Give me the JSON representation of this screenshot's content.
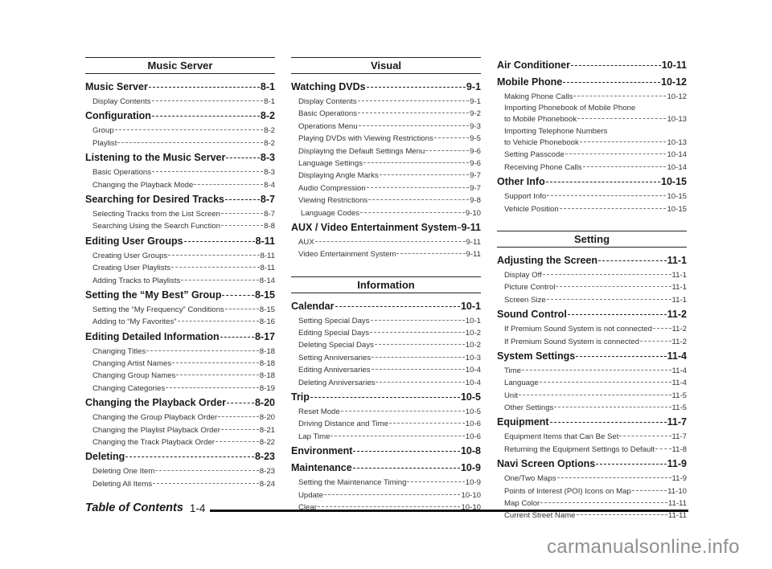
{
  "columns": [
    {
      "sections": [
        {
          "header": "Music Server",
          "entries": [
            {
              "title": "Music Server",
              "page": "8-1",
              "level": 1
            },
            {
              "title": "Display Contents",
              "page": "8-1",
              "level": 2
            },
            {
              "title": "Configuration",
              "page": "8-2",
              "level": 1
            },
            {
              "title": "Group",
              "page": "8-2",
              "level": 2
            },
            {
              "title": "Playlist",
              "page": "8-2",
              "level": 2
            },
            {
              "title": "Listening to the Music Server",
              "page": "8-3",
              "level": 1
            },
            {
              "title": "Basic Operations",
              "page": "8-3",
              "level": 2
            },
            {
              "title": "Changing the Playback Mode",
              "page": "8-4",
              "level": 2
            },
            {
              "title": "Searching for Desired Tracks",
              "page": "8-7",
              "level": 1
            },
            {
              "title": "Selecting Tracks from the List Screen",
              "page": "8-7",
              "level": 2
            },
            {
              "title": "Searching Using the Search Function",
              "page": "8-8",
              "level": 2
            },
            {
              "title": "Editing User Groups",
              "page": "8-11",
              "level": 1
            },
            {
              "title": "Creating User Groups",
              "page": "8-11",
              "level": 2
            },
            {
              "title": "Creating User Playlists",
              "page": "8-11",
              "level": 2
            },
            {
              "title": "Adding Tracks to Playlists",
              "page": "8-14",
              "level": 2
            },
            {
              "title": "Setting the “My Best” Group",
              "page": "8-15",
              "level": 1
            },
            {
              "title": "Setting the “My Frequency” Conditions",
              "page": "8-15",
              "level": 2
            },
            {
              "title": "Adding to “My Favorites”",
              "page": "8-16",
              "level": 2
            },
            {
              "title": "Editing Detailed Information",
              "page": "8-17",
              "level": 1
            },
            {
              "title": "Changing Titles",
              "page": "8-18",
              "level": 2
            },
            {
              "title": "Changing Artist Names",
              "page": "8-18",
              "level": 2
            },
            {
              "title": "Changing Group Names",
              "page": "8-18",
              "level": 2
            },
            {
              "title": "Changing Categories",
              "page": "8-19",
              "level": 2
            },
            {
              "title": "Changing the Playback Order",
              "page": "8-20",
              "level": 1
            },
            {
              "title": "Changing the Group Playback Order",
              "page": "8-20",
              "level": 2
            },
            {
              "title": "Changing the Playlist Playback Order",
              "page": "8-21",
              "level": 2
            },
            {
              "title": "Changing the Track Playback Order",
              "page": "8-22",
              "level": 2
            },
            {
              "title": "Deleting",
              "page": "8-23",
              "level": 1
            },
            {
              "title": "Deleting One Item",
              "page": "8-23",
              "level": 2
            },
            {
              "title": "Deleting All Items",
              "page": "8-24",
              "level": 2
            }
          ]
        }
      ]
    },
    {
      "sections": [
        {
          "header": "Visual",
          "entries": [
            {
              "title": "Watching DVDs",
              "page": "9-1",
              "level": 1
            },
            {
              "title": "Display Contents",
              "page": "9-1",
              "level": 2
            },
            {
              "title": "Basic Operations",
              "page": "9-2",
              "level": 2
            },
            {
              "title": "Operations Menu",
              "page": "9-3",
              "level": 2
            },
            {
              "title": "Playing DVDs with Viewing Restrictions",
              "page": "9-5",
              "level": 2
            },
            {
              "title": "Displaying the Default Settings Menu",
              "page": "9-6",
              "level": 2
            },
            {
              "title": "Language Settings",
              "page": "9-6",
              "level": 2
            },
            {
              "title": "Displaying Angle Marks",
              "page": "9-7",
              "level": 2
            },
            {
              "title": "Audio Compression",
              "page": "9-7",
              "level": 2
            },
            {
              "title": "Viewing Restrictions",
              "page": "9-8",
              "level": 2
            },
            {
              "title": "Language Codes",
              "page": "9-10",
              "level": 3
            },
            {
              "title": "AUX / Video Entertainment System",
              "page": "9-11",
              "level": 1
            },
            {
              "title": "AUX",
              "page": "9-11",
              "level": 2
            },
            {
              "title": "Video Entertainment System",
              "page": "9-11",
              "level": 2
            }
          ]
        },
        {
          "header": "Information",
          "entries": [
            {
              "title": "Calendar",
              "page": "10-1",
              "level": 1
            },
            {
              "title": "Setting Special Days",
              "page": "10-1",
              "level": 2
            },
            {
              "title": "Editing Special Days",
              "page": "10-2",
              "level": 2
            },
            {
              "title": "Deleting Special Days",
              "page": "10-2",
              "level": 2
            },
            {
              "title": "Setting Anniversaries",
              "page": "10-3",
              "level": 2
            },
            {
              "title": "Editing Anniversaries",
              "page": "10-4",
              "level": 2
            },
            {
              "title": "Deleting Anniversaries",
              "page": "10-4",
              "level": 2
            },
            {
              "title": "Trip",
              "page": "10-5",
              "level": 1
            },
            {
              "title": "Reset Mode",
              "page": "10-5",
              "level": 2
            },
            {
              "title": "Driving Distance and Time",
              "page": "10-6",
              "level": 2
            },
            {
              "title": "Lap Time",
              "page": "10-6",
              "level": 2
            },
            {
              "title": "Environment",
              "page": "10-8",
              "level": 1
            },
            {
              "title": "Maintenance",
              "page": "10-9",
              "level": 1
            },
            {
              "title": "Setting the Maintenance Timing",
              "page": "10-9",
              "level": 2
            },
            {
              "title": "Update",
              "page": "10-10",
              "level": 2
            },
            {
              "title": "Clear",
              "page": "10-10",
              "level": 2
            }
          ]
        }
      ]
    },
    {
      "sections": [
        {
          "header": "",
          "entries": [
            {
              "title": "Air Conditioner",
              "page": "10-11",
              "level": 1
            },
            {
              "title": "Mobile Phone",
              "page": "10-12",
              "level": 1
            },
            {
              "title": "Making Phone Calls",
              "page": "10-12",
              "level": 2
            },
            {
              "title": "Importing Phonebook of Mobile Phone",
              "title2": "to Mobile Phonebook",
              "page": "10-13",
              "level": 2
            },
            {
              "title": "Importing Telephone Numbers",
              "title2": "to Vehicle Phonebook",
              "page": "10-13",
              "level": 2
            },
            {
              "title": "Setting Passcode",
              "page": "10-14",
              "level": 2
            },
            {
              "title": "Receiving Phone Calls",
              "page": "10-14",
              "level": 2
            },
            {
              "title": "Other Info",
              "page": "10-15",
              "level": 1
            },
            {
              "title": "Support Info",
              "page": "10-15",
              "level": 2
            },
            {
              "title": "Vehicle Position",
              "page": "10-15",
              "level": 2
            }
          ]
        },
        {
          "header": "Setting",
          "entries": [
            {
              "title": "Adjusting the Screen",
              "page": "11-1",
              "level": 1
            },
            {
              "title": "Display Off",
              "page": "11-1",
              "level": 2
            },
            {
              "title": "Picture Control",
              "page": "11-1",
              "level": 2
            },
            {
              "title": "Screen Size",
              "page": "11-1",
              "level": 2
            },
            {
              "title": "Sound Control",
              "page": "11-2",
              "level": 1
            },
            {
              "title": "If Premium Sound System is not connected",
              "page": "11-2",
              "level": 2
            },
            {
              "title": "If Premium Sound System is connected",
              "page": "11-2",
              "level": 2
            },
            {
              "title": "System Settings",
              "page": "11-4",
              "level": 1
            },
            {
              "title": "Time",
              "page": "11-4",
              "level": 2
            },
            {
              "title": "Language",
              "page": "11-4",
              "level": 2
            },
            {
              "title": "Unit",
              "page": "11-5",
              "level": 2
            },
            {
              "title": "Other Settings",
              "page": "11-5",
              "level": 2
            },
            {
              "title": "Equipment",
              "page": "11-7",
              "level": 1
            },
            {
              "title": "Equipment Items that Can Be Set",
              "page": "11-7",
              "level": 2
            },
            {
              "title": "Returning the Equipment Settings to Default",
              "page": "11-8",
              "level": 2
            },
            {
              "title": "Navi Screen Options",
              "page": "11-9",
              "level": 1
            },
            {
              "title": "One/Two Maps",
              "page": "11-9",
              "level": 2
            },
            {
              "title": "Points of Interest (POI) Icons on Map",
              "page": "11-10",
              "level": 2
            },
            {
              "title": "Map Color",
              "page": "11-11",
              "level": 2
            },
            {
              "title": "Current Street Name",
              "page": "11-11",
              "level": 2
            }
          ]
        }
      ]
    }
  ],
  "footer": {
    "title": "Table of Contents",
    "page": "1-4"
  },
  "watermark": "carmanualsonline.info"
}
